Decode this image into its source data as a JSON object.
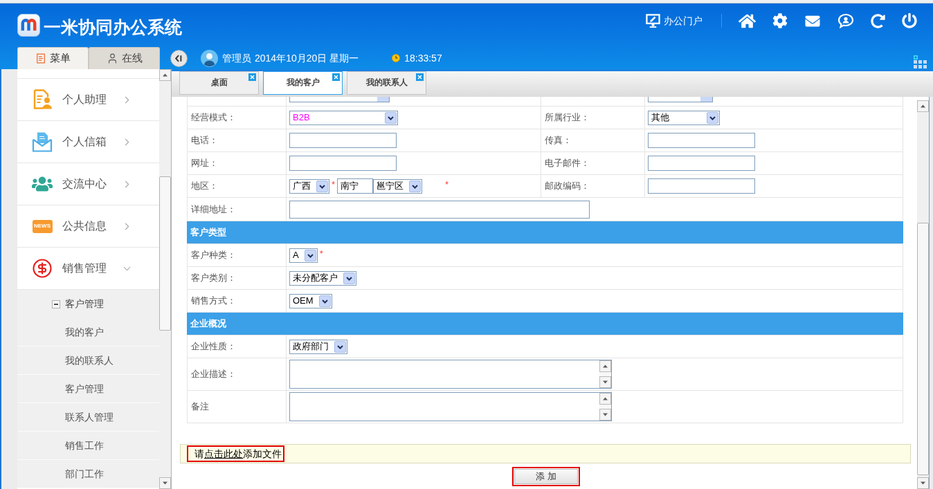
{
  "app": {
    "title": "一米协同办公系统"
  },
  "header": {
    "portal_link": "办公门户",
    "user": "管理员",
    "date": "2014年10月20日 星期一",
    "time": "18:33:57"
  },
  "sidebar": {
    "tabs": [
      {
        "label": "菜单",
        "selected": true
      },
      {
        "label": "在线",
        "selected": false
      }
    ],
    "items": [
      {
        "label": "个人助理",
        "expanded": false
      },
      {
        "label": "个人信箱",
        "expanded": false
      },
      {
        "label": "交流中心",
        "expanded": false
      },
      {
        "label": "公共信息",
        "icon_text": "NEWS",
        "expanded": false
      },
      {
        "label": "销售管理",
        "expanded": true,
        "children": [
          {
            "label": "客户管理",
            "expanded": true,
            "children": [
              {
                "label": "我的客户"
              },
              {
                "label": "我的联系人"
              },
              {
                "label": "客户管理"
              },
              {
                "label": "联系人管理"
              },
              {
                "label": "销售工作"
              },
              {
                "label": "部门工作"
              }
            ]
          }
        ]
      }
    ]
  },
  "tabs": [
    {
      "label": "桌面",
      "selected": false
    },
    {
      "label": "我的客户",
      "selected": true
    },
    {
      "label": "我的联系人",
      "selected": false
    }
  ],
  "form": {
    "rows": [
      {
        "kind": "clipped"
      },
      {
        "kind": "pair",
        "cells": [
          {
            "label": "经营模式：",
            "fields": [
              {
                "kind": "select",
                "value": "B2B",
                "color": "#ff00ff"
              }
            ]
          },
          {
            "label": "所属行业：",
            "fields": [
              {
                "kind": "select",
                "value": "其他"
              }
            ]
          }
        ]
      },
      {
        "kind": "pair",
        "cells": [
          {
            "label": "电话：",
            "fields": [
              {
                "kind": "input"
              }
            ]
          },
          {
            "label": "传真：",
            "fields": [
              {
                "kind": "input"
              }
            ]
          }
        ]
      },
      {
        "kind": "pair",
        "cells": [
          {
            "label": "网址：",
            "fields": [
              {
                "kind": "input"
              }
            ]
          },
          {
            "label": "电子邮件：",
            "fields": [
              {
                "kind": "input"
              }
            ]
          }
        ]
      },
      {
        "kind": "pair",
        "cells": [
          {
            "label": "地区：",
            "fields": [
              {
                "kind": "select",
                "value": "广西"
              },
              {
                "kind": "required",
                "text": "*"
              },
              {
                "kind": "input",
                "value": "南宁"
              },
              {
                "kind": "select",
                "value": "邕宁区"
              },
              {
                "kind": "required",
                "text": "*"
              }
            ]
          },
          {
            "label": "邮政编码：",
            "fields": [
              {
                "kind": "input"
              }
            ]
          }
        ]
      },
      {
        "kind": "single",
        "label": "详细地址：",
        "fields": [
          {
            "kind": "wide_input"
          }
        ]
      },
      {
        "kind": "section",
        "title": "客户类型"
      },
      {
        "kind": "single",
        "label": "客户种类：",
        "fields": [
          {
            "kind": "select",
            "value": "A"
          },
          {
            "kind": "required",
            "text": "*"
          }
        ]
      },
      {
        "kind": "single",
        "label": "客户类别：",
        "fields": [
          {
            "kind": "select",
            "value": "未分配客户"
          }
        ]
      },
      {
        "kind": "single",
        "label": "销售方式：",
        "fields": [
          {
            "kind": "select",
            "value": "OEM"
          }
        ]
      },
      {
        "kind": "section",
        "title": "企业概况"
      },
      {
        "kind": "single",
        "label": "企业性质：",
        "fields": [
          {
            "kind": "select",
            "value": "政府部门"
          }
        ]
      },
      {
        "kind": "single",
        "label": "企业描述：",
        "fields": [
          {
            "kind": "textarea"
          }
        ]
      },
      {
        "kind": "single",
        "label": "备注",
        "fields": [
          {
            "kind": "textarea"
          }
        ]
      }
    ]
  },
  "attachment": {
    "prefix": "请",
    "link": "点击此处",
    "suffix": "添加文件"
  },
  "submit": {
    "label": "添 加"
  }
}
